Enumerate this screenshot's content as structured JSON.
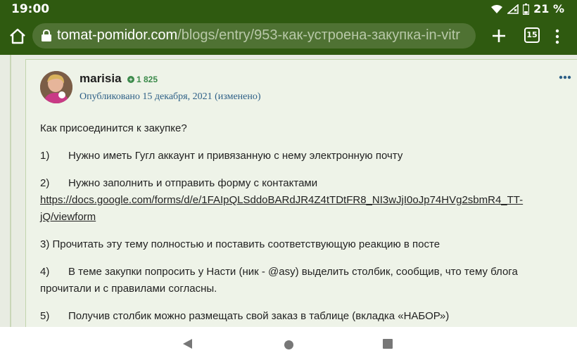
{
  "status": {
    "time": "19:00",
    "battery": "21 %"
  },
  "browser": {
    "url_domain": "tomat-pomidor.com",
    "url_path": "/blogs/entry/953-как-устроена-закупка-in-vitr",
    "tabs_count": "15"
  },
  "post": {
    "author": "marisia",
    "reputation": "1 825",
    "published": "Опубликовано 15 декабря, 2021 (изменено)",
    "lines": {
      "q": "Как присоединится к закупке?",
      "s1_num": "1)",
      "s1": "Нужно иметь Гугл аккаунт и привязанную с нему электронную почту",
      "s2_num": "2)",
      "s2": "Нужно заполнить и отправить форму с контактами",
      "s2_link": "https://docs.google.com/forms/d/e/1FAIpQLSddoBARdJR4Z4tTDtFR8_NI3wJjI0oJp74HVg2sbmR4_TT-jQ/viewform",
      "s3": "3) Прочитать эту тему полностью и поставить соответствующую реакцию в посте",
      "s4_num": "4)",
      "s4": "В теме закупки попросить у Насти (ник - @asy) выделить столбик, сообщив, что  тему блога прочитали и с правилами согласны.",
      "s5_num": "5)",
      "s5": "Получив столбик можно размещать свой заказ в таблице  (вкладка «НАБОР»)"
    }
  },
  "colors": {
    "toolbar": "#2f5a10",
    "card_bg": "#eef3e8",
    "published_link": "#2d5f86"
  }
}
